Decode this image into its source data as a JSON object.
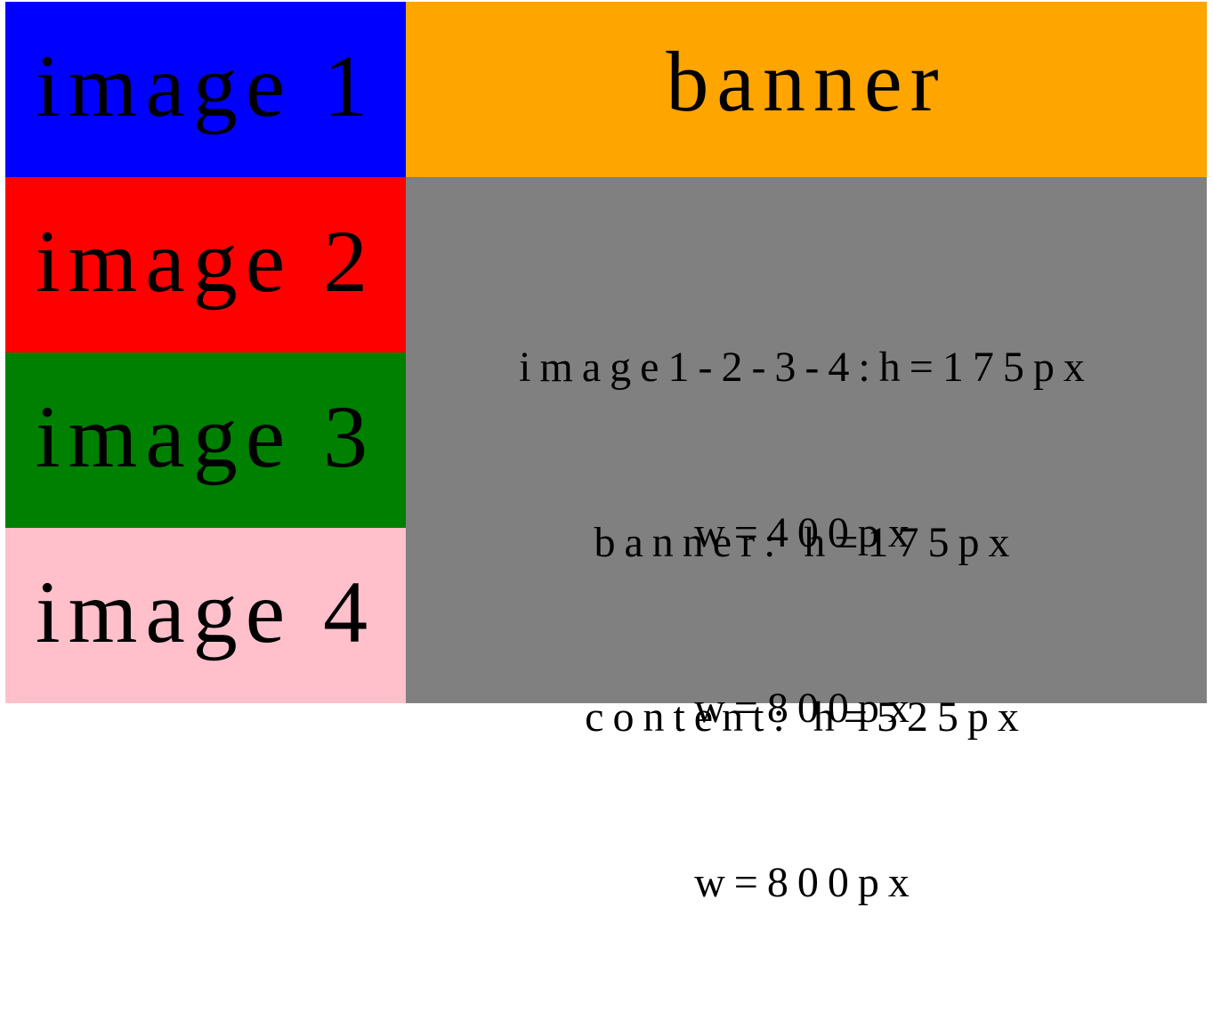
{
  "blocks": [
    {
      "label": "image 1",
      "color": "#0000ff"
    },
    {
      "label": "image 2",
      "color": "#ff0000"
    },
    {
      "label": "image 3",
      "color": "#008000"
    },
    {
      "label": "image 4",
      "color": "#ffc0cb"
    }
  ],
  "banner": {
    "label": "banner",
    "color": "#ffa500"
  },
  "content": {
    "color": "#808080",
    "specs": [
      {
        "line1": "image1-2-3-4:h=175px",
        "line2": "w=400px"
      },
      {
        "line1": "banner: h=175px",
        "line2": "w=800px"
      },
      {
        "line1": "content: h=525px",
        "line2": "w=800px"
      }
    ]
  }
}
